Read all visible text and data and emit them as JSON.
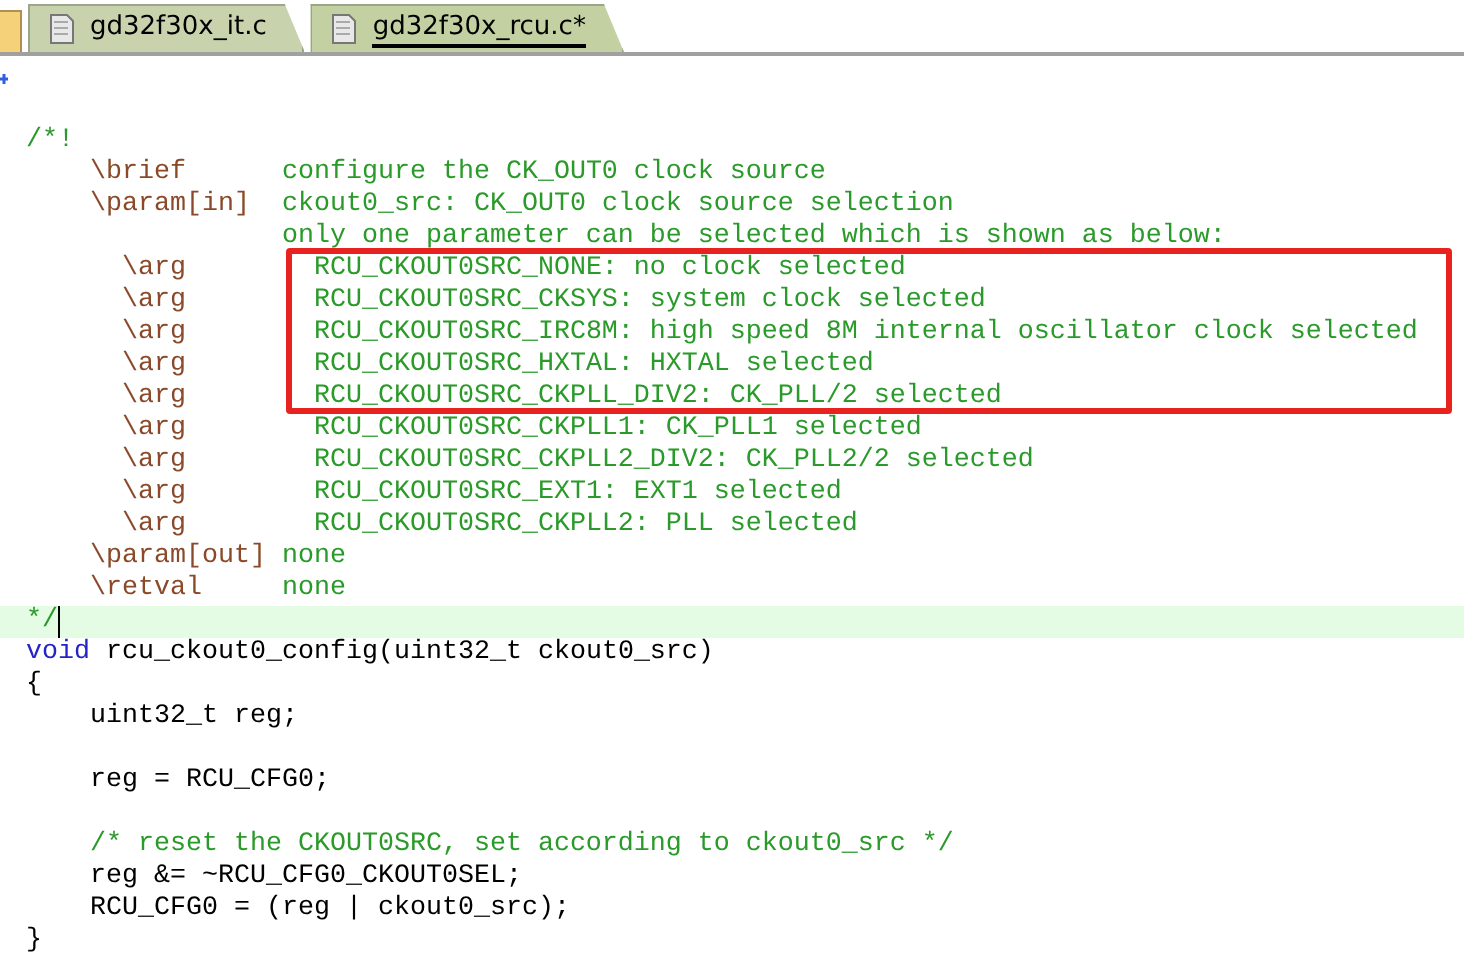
{
  "tabs": [
    {
      "label": "gd32f30x_it.c",
      "selected": false
    },
    {
      "label": "gd32f30x_rcu.c*",
      "selected": true
    }
  ],
  "editor": {
    "lines": [
      {
        "kind": "fold"
      },
      {
        "kind": "blank"
      },
      {
        "kind": "code",
        "tokens": [
          {
            "text": "/*!",
            "kind": "comment"
          }
        ]
      },
      {
        "kind": "code",
        "tokens": [
          {
            "text": "    \\brief",
            "kind": "tag"
          },
          {
            "text": "      configure the CK_OUT0 clock source",
            "kind": "comment"
          }
        ]
      },
      {
        "kind": "code",
        "tokens": [
          {
            "text": "    \\param[in]",
            "kind": "tag"
          },
          {
            "text": "  ckout0_src: CK_OUT0 clock source selection",
            "kind": "comment"
          }
        ]
      },
      {
        "kind": "code",
        "tokens": [
          {
            "text": "                only one parameter can be selected which is shown as below:",
            "kind": "comment"
          }
        ]
      },
      {
        "kind": "code",
        "highlighted": true,
        "tokens": [
          {
            "text": "      \\arg",
            "kind": "tag"
          },
          {
            "text": "        RCU_CKOUT0SRC_NONE: no clock selected",
            "kind": "comment"
          }
        ]
      },
      {
        "kind": "code",
        "highlighted": true,
        "tokens": [
          {
            "text": "      \\arg",
            "kind": "tag"
          },
          {
            "text": "        RCU_CKOUT0SRC_CKSYS: system clock selected",
            "kind": "comment"
          }
        ]
      },
      {
        "kind": "code",
        "highlighted": true,
        "tokens": [
          {
            "text": "      \\arg",
            "kind": "tag"
          },
          {
            "text": "        RCU_CKOUT0SRC_IRC8M: high speed 8M internal oscillator clock selected",
            "kind": "comment"
          }
        ]
      },
      {
        "kind": "code",
        "highlighted": true,
        "tokens": [
          {
            "text": "      \\arg",
            "kind": "tag"
          },
          {
            "text": "        RCU_CKOUT0SRC_HXTAL: HXTAL selected",
            "kind": "comment"
          }
        ]
      },
      {
        "kind": "code",
        "highlighted": true,
        "tokens": [
          {
            "text": "      \\arg",
            "kind": "tag"
          },
          {
            "text": "        RCU_CKOUT0SRC_CKPLL_DIV2: CK_PLL/2 selected",
            "kind": "comment"
          }
        ]
      },
      {
        "kind": "code",
        "tokens": [
          {
            "text": "      \\arg",
            "kind": "tag"
          },
          {
            "text": "        RCU_CKOUT0SRC_CKPLL1: CK_PLL1 selected",
            "kind": "comment"
          }
        ]
      },
      {
        "kind": "code",
        "tokens": [
          {
            "text": "      \\arg",
            "kind": "tag"
          },
          {
            "text": "        RCU_CKOUT0SRC_CKPLL2_DIV2: CK_PLL2/2 selected",
            "kind": "comment"
          }
        ]
      },
      {
        "kind": "code",
        "tokens": [
          {
            "text": "      \\arg",
            "kind": "tag"
          },
          {
            "text": "        RCU_CKOUT0SRC_EXT1: EXT1 selected",
            "kind": "comment"
          }
        ]
      },
      {
        "kind": "code",
        "tokens": [
          {
            "text": "      \\arg",
            "kind": "tag"
          },
          {
            "text": "        RCU_CKOUT0SRC_CKPLL2: PLL selected",
            "kind": "comment"
          }
        ]
      },
      {
        "kind": "code",
        "tokens": [
          {
            "text": "    \\param[out]",
            "kind": "tag"
          },
          {
            "text": " none",
            "kind": "comment"
          }
        ]
      },
      {
        "kind": "code",
        "tokens": [
          {
            "text": "    \\retval",
            "kind": "tag"
          },
          {
            "text": "     none",
            "kind": "comment"
          }
        ]
      },
      {
        "kind": "code",
        "current": true,
        "tokens": [
          {
            "text": "*/",
            "kind": "comment"
          }
        ]
      },
      {
        "kind": "code",
        "tokens": [
          {
            "text": "void",
            "kind": "keyword"
          },
          {
            "text": " rcu_ckout0_config(uint32_t ckout0_src)",
            "kind": "plain"
          }
        ]
      },
      {
        "kind": "code",
        "tokens": [
          {
            "text": "{",
            "kind": "plain"
          }
        ]
      },
      {
        "kind": "code",
        "tokens": [
          {
            "text": "    uint32_t reg;",
            "kind": "plain"
          }
        ]
      },
      {
        "kind": "blank"
      },
      {
        "kind": "code",
        "tokens": [
          {
            "text": "    reg = RCU_CFG0;",
            "kind": "plain"
          }
        ]
      },
      {
        "kind": "blank"
      },
      {
        "kind": "code",
        "tokens": [
          {
            "text": "    /* reset the CKOUT0SRC, set according to ckout0_src */",
            "kind": "comment"
          }
        ]
      },
      {
        "kind": "code",
        "tokens": [
          {
            "text": "    reg &= ~RCU_CFG0_CKOUT0SEL;",
            "kind": "plain"
          }
        ]
      },
      {
        "kind": "code",
        "tokens": [
          {
            "text": "    RCU_CFG0 = (reg | ckout0_src);",
            "kind": "plain"
          }
        ]
      },
      {
        "kind": "code",
        "tokens": [
          {
            "text": "}",
            "kind": "plain"
          }
        ]
      }
    ]
  }
}
